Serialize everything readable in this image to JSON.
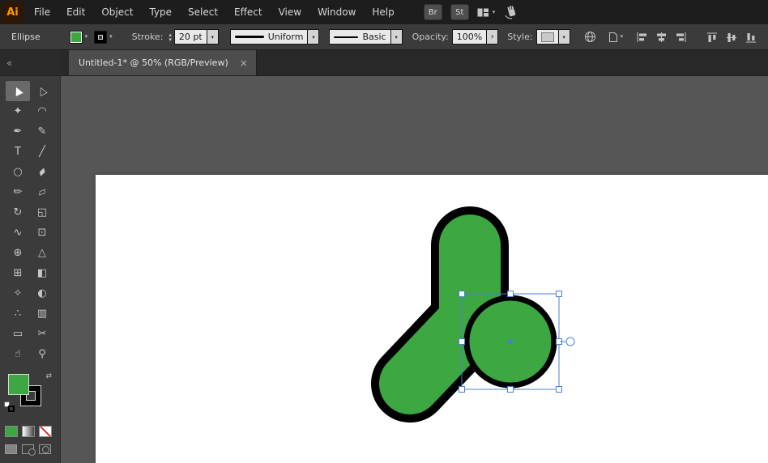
{
  "colors": {
    "object_green": "#3da742",
    "selection_blue": "#4a7fd6",
    "logo_orange": "#ff9a00"
  },
  "menubar": {
    "logo": "Ai",
    "menus": [
      "File",
      "Edit",
      "Object",
      "Type",
      "Select",
      "Effect",
      "View",
      "Window",
      "Help"
    ],
    "bridge": "Br",
    "stock": "St"
  },
  "control_bar": {
    "context": "Ellipse",
    "stroke_label": "Stroke:",
    "stroke_width": "20 pt",
    "width_profile": "Uniform",
    "brush": "Basic",
    "opacity_label": "Opacity:",
    "opacity": "100%",
    "style_label": "Style:"
  },
  "tab": {
    "title": "Untitled-1* @ 50% (RGB/Preview)",
    "close": "×"
  },
  "icons": {
    "chevron_down": "▾",
    "stepper_up": "▴",
    "stepper_down": "▾",
    "flyout_right": "›"
  },
  "toolbar": {
    "collapse": "«",
    "swap_glyph": "⇄",
    "tools": [
      {
        "name": "selection",
        "glyph": "▶",
        "rot": -115,
        "selected": true
      },
      {
        "name": "direct-selection",
        "glyph": "▷",
        "rot": -115
      },
      {
        "name": "magic-wand",
        "glyph": "✦"
      },
      {
        "name": "lasso",
        "glyph": "◠"
      },
      {
        "name": "pen",
        "glyph": "✒"
      },
      {
        "name": "curvature",
        "glyph": "✎"
      },
      {
        "name": "type",
        "glyph": "T"
      },
      {
        "name": "line-segment",
        "glyph": "╱"
      },
      {
        "name": "ellipse",
        "glyph": "○"
      },
      {
        "name": "paintbrush",
        "glyph": "▰",
        "rot": -45
      },
      {
        "name": "pencil",
        "glyph": "✏"
      },
      {
        "name": "eraser",
        "glyph": "▱",
        "rot": -20
      },
      {
        "name": "rotate",
        "glyph": "↻"
      },
      {
        "name": "scale",
        "glyph": "◱"
      },
      {
        "name": "width",
        "glyph": "∿"
      },
      {
        "name": "free-transform",
        "glyph": "⊡"
      },
      {
        "name": "shape-builder",
        "glyph": "⊕"
      },
      {
        "name": "perspective-grid",
        "glyph": "△"
      },
      {
        "name": "mesh",
        "glyph": "⊞"
      },
      {
        "name": "gradient",
        "glyph": "◧"
      },
      {
        "name": "eyedropper",
        "glyph": "✧"
      },
      {
        "name": "blend",
        "glyph": "◐"
      },
      {
        "name": "symbol-sprayer",
        "glyph": "∴"
      },
      {
        "name": "column-graph",
        "glyph": "▥"
      },
      {
        "name": "artboard",
        "glyph": "▭"
      },
      {
        "name": "slice",
        "glyph": "✂"
      },
      {
        "name": "hand",
        "glyph": "☝"
      },
      {
        "name": "zoom",
        "glyph": "⚲"
      }
    ]
  }
}
